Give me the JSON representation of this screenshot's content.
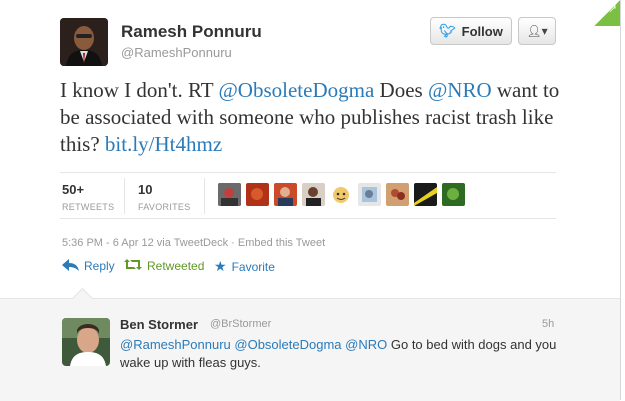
{
  "tweet": {
    "author_name": "Ramesh Ponnuru",
    "author_handle": "@RameshPonnuru",
    "follow_label": "Follow",
    "text_pre": "I know I don't. RT ",
    "mention1": "@ObsoleteDogma",
    "text_mid": " Does ",
    "mention2": "@NRO",
    "text_post": " want to be associated with someone who publishes racist trash like this? ",
    "link": "bit.ly/Ht4hmz",
    "retweets_count": "50+",
    "retweets_label": "RETWEETS",
    "favorites_count": "10",
    "favorites_label": "FAVORITES",
    "meta_time": "5:36 PM - 6 Apr 12",
    "meta_via": " via TweetDeck",
    "meta_sep": " · ",
    "meta_embed": "Embed this Tweet",
    "actions": {
      "reply": "Reply",
      "retweeted": "Retweeted",
      "favorite": "Favorite"
    }
  },
  "reply": {
    "name": "Ben Stormer",
    "handle": "@BrStormer",
    "time": "5h",
    "mention1": "@RameshPonnuru",
    "mention2": "@ObsoleteDogma",
    "mention3": "@NRO",
    "text": " Go to bed with dogs and you wake up with fleas guys."
  },
  "colors": {
    "link": "#2b7bb9",
    "retweet_green": "#609928",
    "twitter_blue": "#2fa3e6"
  }
}
